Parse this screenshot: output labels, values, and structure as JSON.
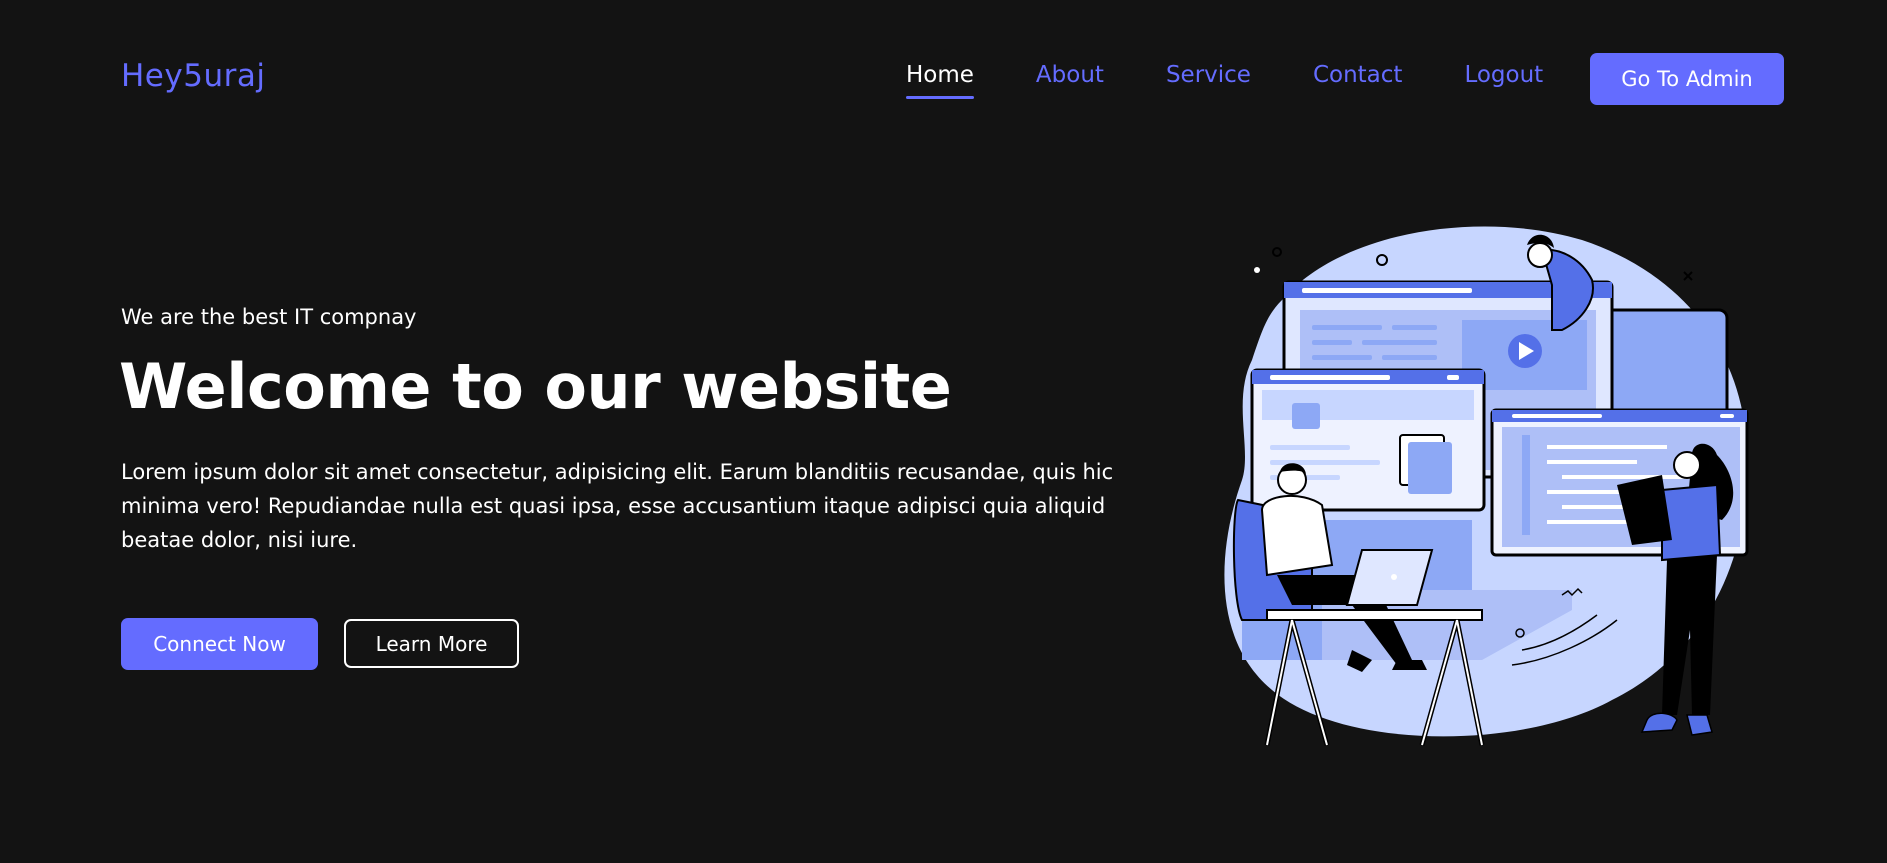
{
  "header": {
    "logo": "Hey5uraj",
    "nav": [
      {
        "label": "Home",
        "active": true
      },
      {
        "label": "About"
      },
      {
        "label": "Service"
      },
      {
        "label": "Contact"
      },
      {
        "label": "Logout"
      }
    ],
    "admin_button": "Go To Admin"
  },
  "hero": {
    "tagline": "We are the best IT compnay",
    "headline": "Welcome to our website",
    "description": "Lorem ipsum dolor sit amet consectetur, adipisicing elit. Earum blanditiis recusandae, quis hic minima vero! Repudiandae nulla est quasi ipsa, esse accusantium itaque adipisci quia aliquid beatae dolor, nisi iure.",
    "primary_button": "Connect Now",
    "secondary_button": "Learn More"
  },
  "colors": {
    "background": "#131313",
    "accent": "#646cff",
    "text": "#ffffff",
    "illustration_light": "#c7d6ff",
    "illustration_mid": "#8da8f5",
    "illustration_dark": "#5470e8"
  },
  "illustration": {
    "icon": "web-team-illustration"
  }
}
